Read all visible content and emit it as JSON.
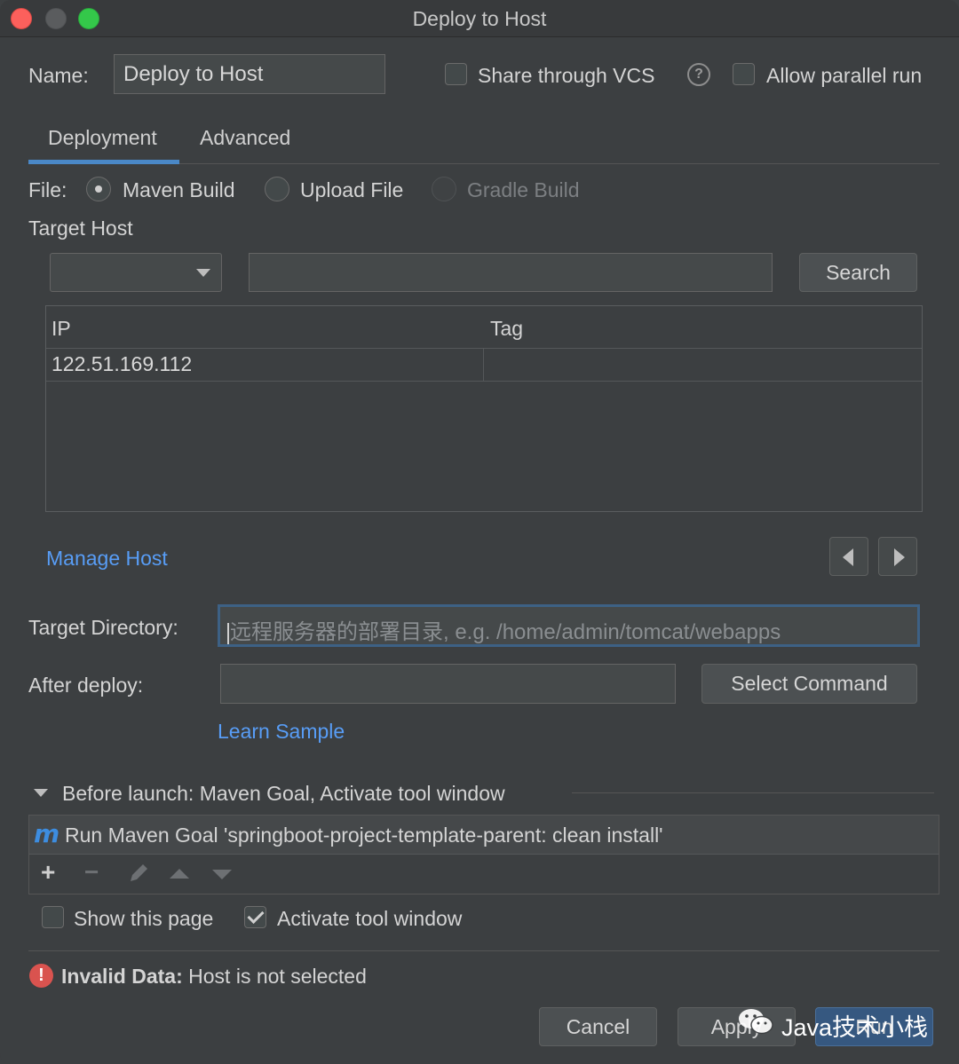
{
  "window": {
    "title": "Deploy to Host"
  },
  "name_row": {
    "label": "Name:",
    "value": "Deploy to Host",
    "share_vcs": "Share through VCS",
    "help_glyph": "?",
    "allow_parallel": "Allow parallel run"
  },
  "tabs": [
    {
      "label": "Deployment",
      "active": true
    },
    {
      "label": "Advanced",
      "active": false
    }
  ],
  "file": {
    "label": "File:",
    "options": [
      {
        "label": "Maven Build",
        "selected": true,
        "enabled": true
      },
      {
        "label": "Upload File",
        "selected": false,
        "enabled": true
      },
      {
        "label": "Gradle Build",
        "selected": false,
        "enabled": false
      }
    ]
  },
  "target_host": {
    "label": "Target Host",
    "combo_value": "",
    "search_value": "",
    "search_button": "Search",
    "columns": [
      "IP",
      "Tag"
    ],
    "rows": [
      {
        "ip": "122.51.169.112",
        "tag": ""
      }
    ],
    "manage_link": "Manage Host"
  },
  "target_directory": {
    "label": "Target Directory:",
    "placeholder": "远程服务器的部署目录, e.g. /home/admin/tomcat/webapps"
  },
  "after_deploy": {
    "label": "After deploy:",
    "value": "",
    "select_button": "Select Command",
    "learn_link": "Learn Sample"
  },
  "before_launch": {
    "title": "Before launch: Maven Goal, Activate tool window",
    "item": "Run Maven Goal 'springboot-project-template-parent: clean install'",
    "item_icon": "m",
    "toolbar": {
      "add": "+",
      "remove": "−"
    }
  },
  "options": {
    "show_page": "Show this page",
    "show_page_checked": false,
    "activate_tool": "Activate tool window",
    "activate_tool_checked": true
  },
  "error": {
    "icon": "!",
    "title": "Invalid Data:",
    "message": "Host is not selected"
  },
  "buttons": {
    "cancel": "Cancel",
    "apply": "Apply",
    "run": "Run"
  },
  "watermark": "Java技术小栈",
  "colors": {
    "background": "#3c3f41",
    "accent": "#4a88c7",
    "link": "#589df6",
    "error": "#d9534f",
    "run_button": "#365880"
  }
}
